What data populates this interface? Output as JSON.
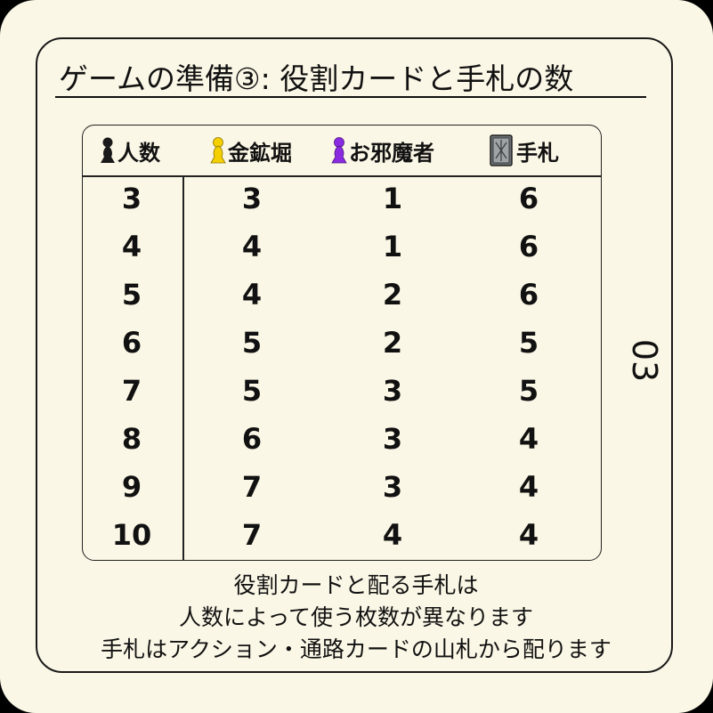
{
  "title": "ゲームの準備③: 役割カードと手札の数",
  "page_number": "03",
  "colors": {
    "background": "#fbf7e6",
    "player_icon": "#1a1a1a",
    "miner_icon": "#f5d000",
    "saboteur_icon": "#8a2be2"
  },
  "table": {
    "headers": [
      {
        "label": "人数",
        "icon": "player-pawn-icon"
      },
      {
        "label": "金鉱堀",
        "icon": "gold-miner-pawn-icon"
      },
      {
        "label": "お邪魔者",
        "icon": "saboteur-pawn-icon"
      },
      {
        "label": "手札",
        "icon": "card-icon"
      }
    ],
    "rows": [
      [
        "3",
        "3",
        "1",
        "6"
      ],
      [
        "4",
        "4",
        "1",
        "6"
      ],
      [
        "5",
        "4",
        "2",
        "6"
      ],
      [
        "6",
        "5",
        "2",
        "5"
      ],
      [
        "7",
        "5",
        "3",
        "5"
      ],
      [
        "8",
        "6",
        "3",
        "4"
      ],
      [
        "9",
        "7",
        "3",
        "4"
      ],
      [
        "10",
        "7",
        "4",
        "4"
      ]
    ]
  },
  "notes": [
    "役割カードと配る手札は",
    "人数によって使う枚数が異なります",
    "手札はアクション・通路カードの山札から配ります"
  ]
}
